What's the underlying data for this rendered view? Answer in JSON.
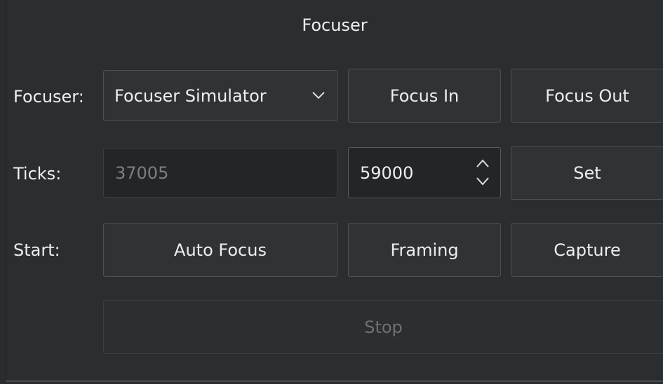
{
  "title": "Focuser",
  "rows": {
    "focuser": {
      "label": "Focuser:",
      "device_selected": "Focuser Simulator",
      "focus_in_label": "Focus In",
      "focus_out_label": "Focus Out"
    },
    "ticks": {
      "label": "Ticks:",
      "current_value": "37005",
      "target_value": "59000",
      "set_label": "Set"
    },
    "start": {
      "label": "Start:",
      "auto_focus_label": "Auto Focus",
      "framing_label": "Framing",
      "capture_label": "Capture"
    },
    "stop_label": "Stop"
  },
  "icons": {
    "combo_arrow": "chevron-down-icon",
    "spin_arrows": "spin-updown-icon"
  },
  "colors": {
    "background": "#2b2e31",
    "text": "#eeeeee",
    "disabled_text": "#6e7174"
  }
}
